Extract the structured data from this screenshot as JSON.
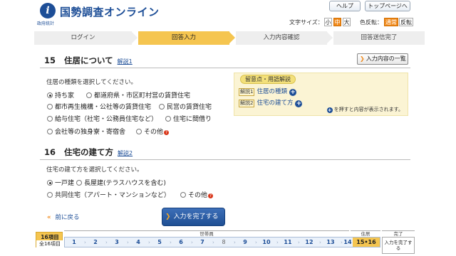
{
  "header": {
    "logo_sub": "政府統計",
    "site_title": "国勢調査オンライン",
    "help_label": "ヘルプ",
    "toppage_label": "トップページへ",
    "font_size_label": "文字サイズ：",
    "font_size_options": [
      "小",
      "中",
      "大"
    ],
    "font_size_selected": "中",
    "color_label": "色反転：",
    "color_options": [
      "通常",
      "反転"
    ],
    "color_selected": "通常"
  },
  "steps": [
    {
      "label": "ログイン",
      "active": false
    },
    {
      "label": "回答入力",
      "active": true
    },
    {
      "label": "入力内容確認",
      "active": false
    },
    {
      "label": "回答送信完了",
      "active": false
    }
  ],
  "list_button_label": "入力内容の一覧",
  "q15": {
    "number": "15",
    "title": "住居について",
    "hint_link": "解説1",
    "instruction": "住居の種類を選択してください。",
    "options": [
      "持ち家",
      "都道府県・市区町村営の賃貸住宅",
      "都市再生機構・公社等の賃貸住宅",
      "民営の賃貸住宅",
      "給与住宅（社宅・公務員住宅など）",
      "住宅に間借り",
      "会社等の独身寮・寄宿舎",
      "その他"
    ],
    "selected": "持ち家"
  },
  "q16": {
    "number": "16",
    "title": "住宅の建て方",
    "hint_link": "解説2",
    "instruction": "住宅の建て方を選択してください。",
    "options": [
      "一戸建",
      "長屋建(テラスハウスを含む)",
      "共同住宅（アパート・マンションなど）",
      "その他"
    ],
    "selected": "一戸建"
  },
  "notes": {
    "title": "留意点・用語解説",
    "items": [
      {
        "tag": "解説1",
        "label": "住居の種類"
      },
      {
        "tag": "解説2",
        "label": "住宅の建て方"
      }
    ],
    "footer": "を押すと内容が表示されます。"
  },
  "nav": {
    "back_label": "前に戻る",
    "complete_label": "入力を完了する"
  },
  "progress": {
    "current_label": "16項目",
    "total_label": "全16項目",
    "group_household": "世帯員",
    "group_housing": "住居",
    "group_done": "完了",
    "cells": [
      "1",
      "2",
      "3",
      "4",
      "5",
      "6",
      "7",
      "8",
      "9",
      "10",
      "11",
      "12",
      "13",
      "14",
      "15•16"
    ],
    "to_complete_label": "入力を完了する"
  },
  "colors": {
    "brand_blue": "#1d4e97",
    "accent_orange": "#f08a1c",
    "active_yellow": "#f5c550"
  }
}
